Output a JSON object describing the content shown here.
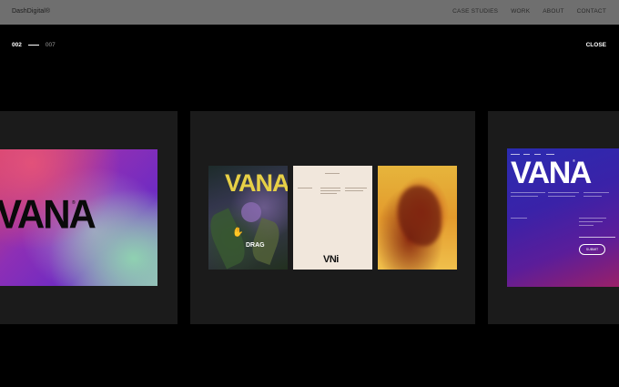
{
  "header": {
    "brand": "DashDigital®",
    "nav": [
      "CASE STUDIES",
      "WORK",
      "ABOUT",
      "CONTACT"
    ]
  },
  "overlay": {
    "counter_current": "002",
    "counter_total": "007",
    "close_label": "CLOSE"
  },
  "slides": {
    "slide1_word": "VANA",
    "slide1_reg": "®",
    "poster_a_word": "VANA",
    "drag_label": "DRAG",
    "poster_b_mark": "VNi",
    "slide3_word": "VANA",
    "slide3_reg": "®",
    "slide3_button": "SUBMIT"
  },
  "colors": {
    "topbar": "#6f6f6f",
    "background": "#000000",
    "card": "#1b1b1b",
    "poster_yellow": "#e7d046"
  }
}
